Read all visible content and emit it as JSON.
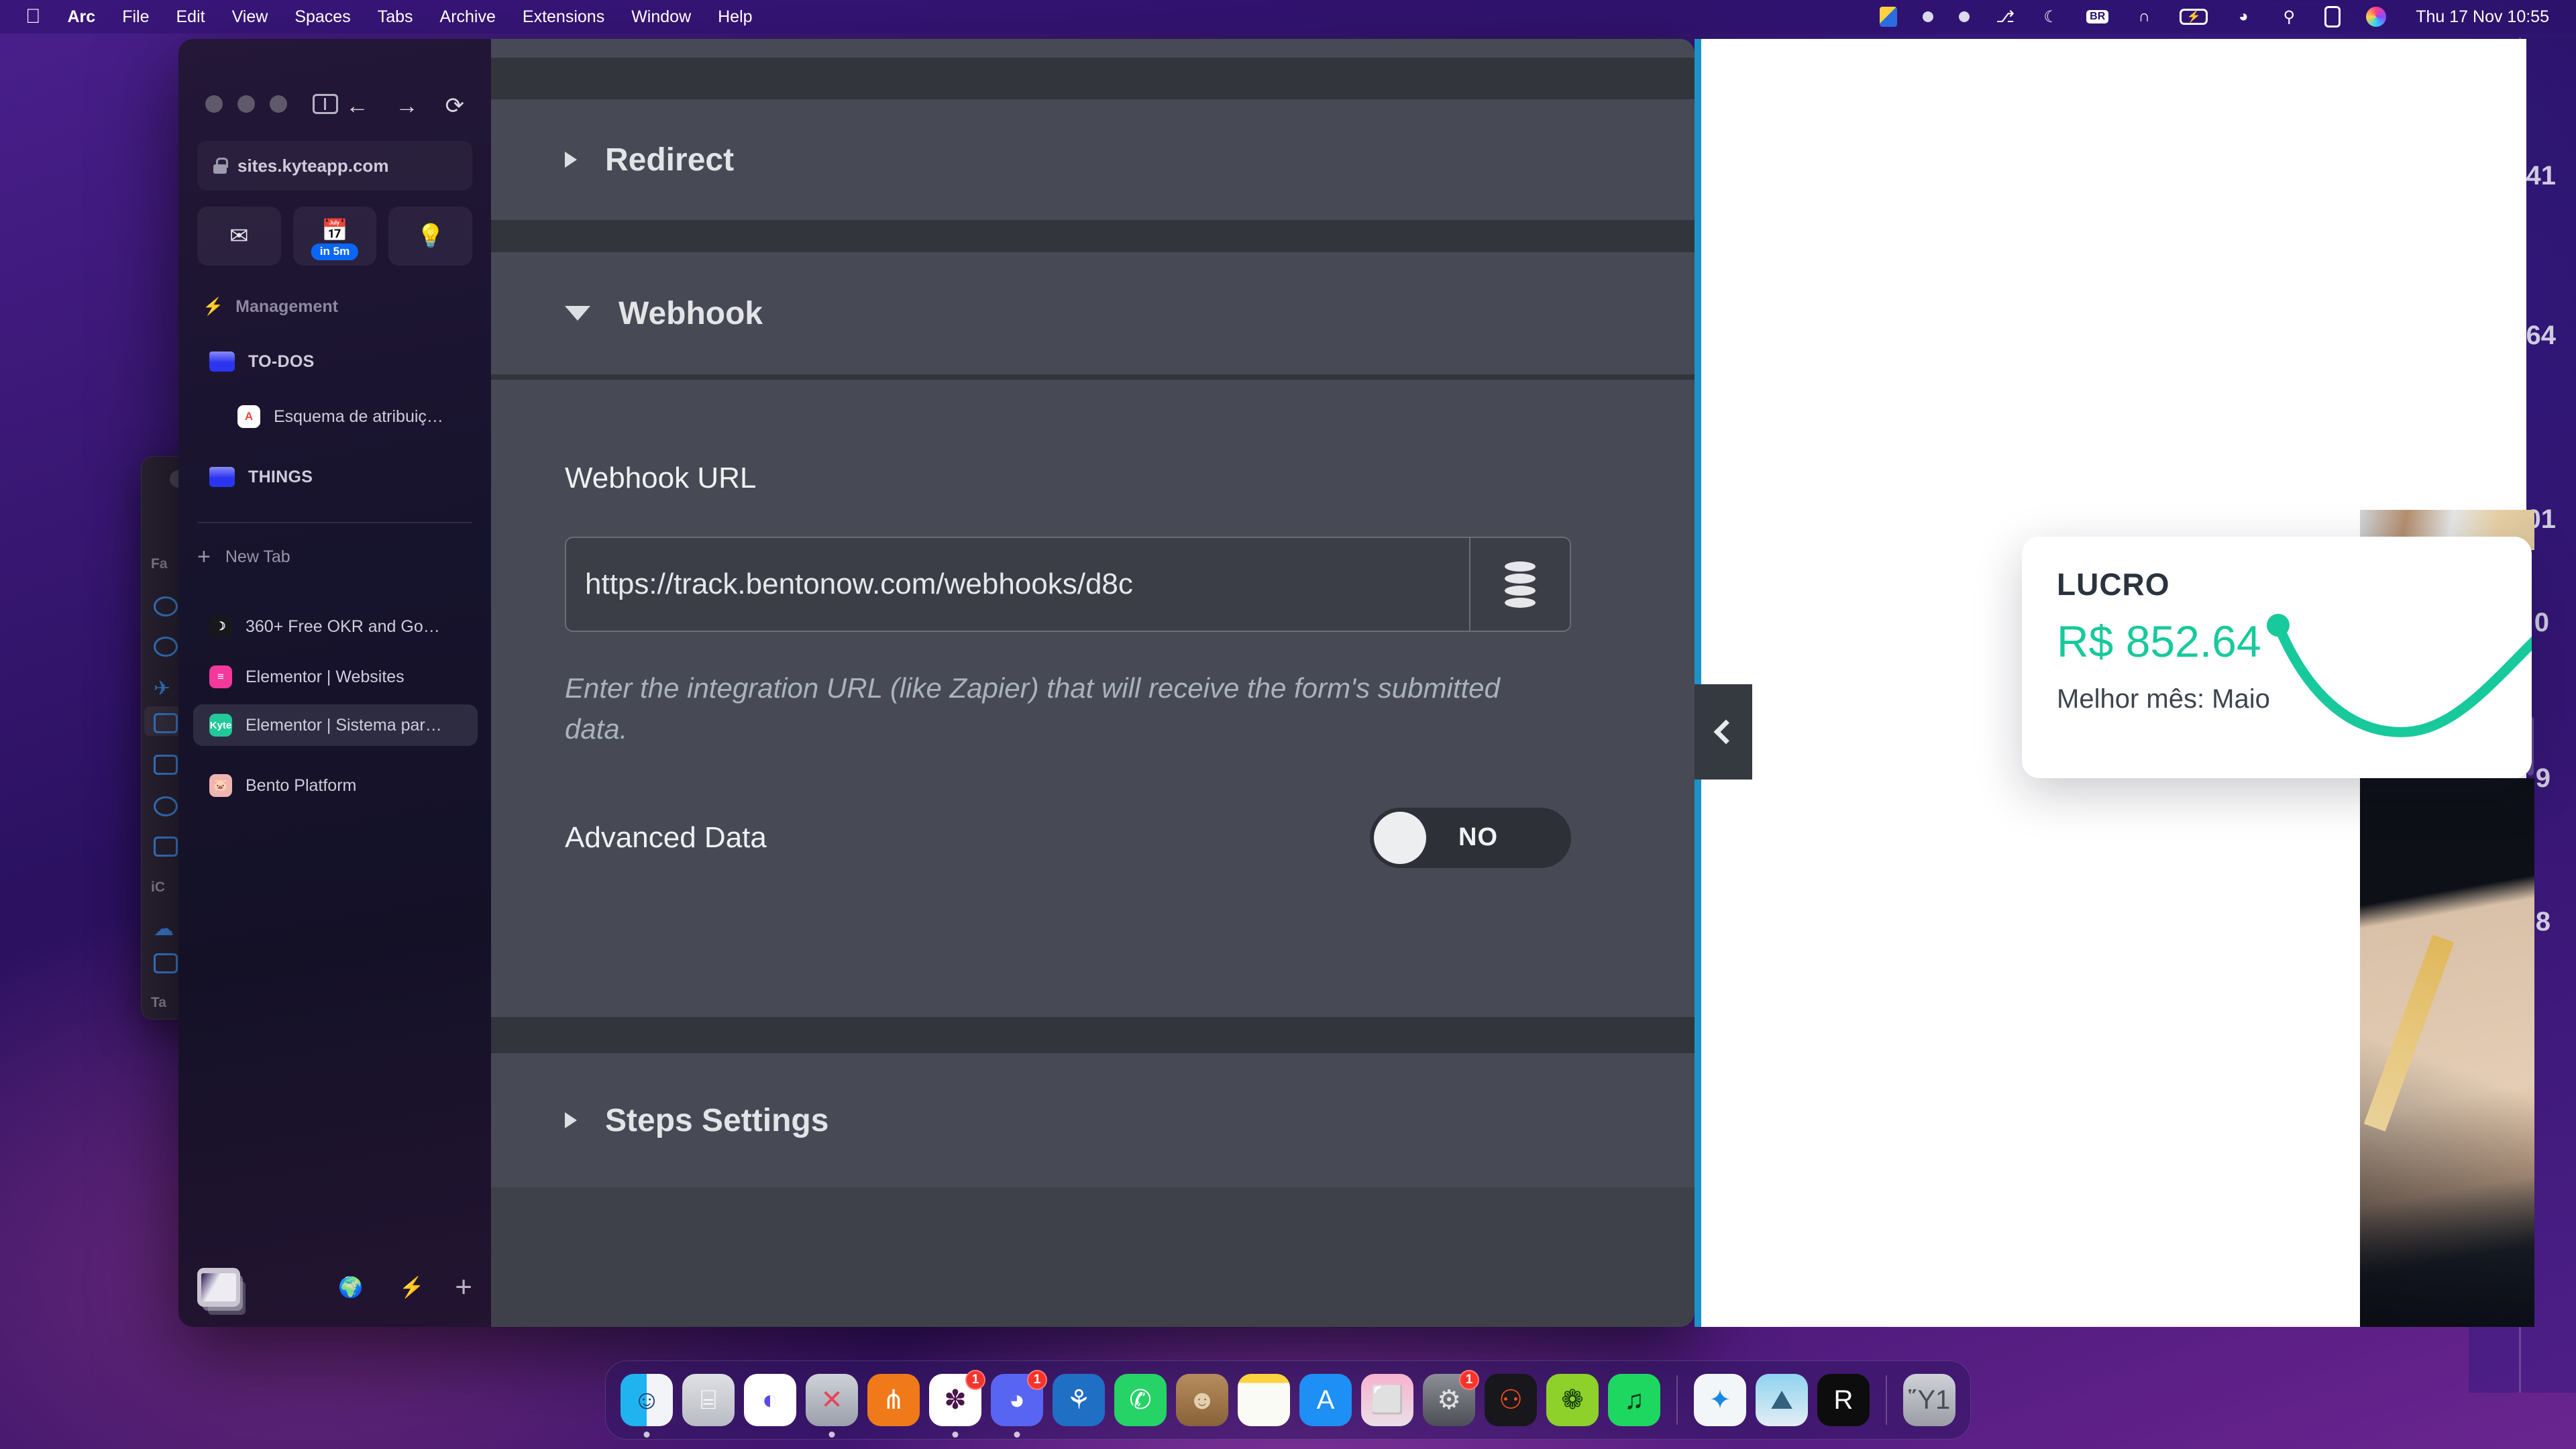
{
  "menubar": {
    "apple_icon": "apple-logo",
    "items": [
      {
        "label": "Arc",
        "bold": true
      },
      {
        "label": "File",
        "bold": false
      },
      {
        "label": "Edit",
        "bold": false
      },
      {
        "label": "View",
        "bold": false
      },
      {
        "label": "Spaces",
        "bold": false
      },
      {
        "label": "Tabs",
        "bold": false
      },
      {
        "label": "Archive",
        "bold": false
      },
      {
        "label": "Extensions",
        "bold": false
      },
      {
        "label": "Window",
        "bold": false
      },
      {
        "label": "Help",
        "bold": false
      }
    ],
    "status_icons": [
      {
        "name": "screen-share-icon",
        "glyph": "◧"
      },
      {
        "name": "status-dot-icon",
        "glyph": ""
      },
      {
        "name": "status-dot-2-icon",
        "glyph": ""
      },
      {
        "name": "bluetooth-icon",
        "glyph": "⎇"
      },
      {
        "name": "do-not-disturb-moon-icon",
        "glyph": "☾"
      },
      {
        "name": "input-language-icon",
        "glyph": "BR"
      },
      {
        "name": "headphones-icon",
        "glyph": "∩"
      },
      {
        "name": "battery-charging-icon",
        "glyph": "⚡"
      },
      {
        "name": "wifi-icon",
        "glyph": "◔"
      },
      {
        "name": "spotlight-search-icon",
        "glyph": "⚲"
      },
      {
        "name": "control-center-icon",
        "glyph": "⌸"
      },
      {
        "name": "siri-icon",
        "glyph": "●"
      }
    ],
    "clock": "Thu 17 Nov  10:55"
  },
  "finder_window": {
    "sections": [
      "Fa",
      "iC",
      "Ta"
    ]
  },
  "browser": {
    "url": "sites.kyteapp.com",
    "nav": {
      "back_icon": "arrow-left-icon",
      "forward_icon": "arrow-right-icon",
      "reload_icon": "reload-icon",
      "sidebar_toggle_icon": "sidebar-toggle-icon"
    },
    "pinned": [
      {
        "name": "mail-tile",
        "glyph": "✉",
        "badge": ""
      },
      {
        "name": "calendar-tile",
        "glyph": "▤",
        "badge": "in 5m"
      },
      {
        "name": "ideas-tile",
        "glyph": "Ὂ1",
        "badge": ""
      }
    ],
    "space_label": "Management",
    "space_icon": "bolt-icon",
    "sidebar_items": [
      {
        "label": "TO-DOS",
        "type": "folder",
        "active": false,
        "indent": false
      },
      {
        "label": "Esquema de atribuiç…",
        "type": "tab",
        "active": false,
        "indent": true,
        "favicon": "A",
        "favicon_bg": "#ffffff",
        "favicon_color": "#e8453c"
      },
      {
        "label": "THINGS",
        "type": "folder",
        "active": false,
        "indent": false
      }
    ],
    "new_tab_label": "New Tab",
    "tabs": [
      {
        "label": "360+ Free OKR and Go…",
        "active": false,
        "favicon": "☽",
        "favicon_bg": "#17171c",
        "favicon_color": "#ffffff"
      },
      {
        "label": "Elementor | Websites",
        "active": false,
        "favicon": "≡",
        "favicon_bg": "#f4389c",
        "favicon_color": "#ffffff"
      },
      {
        "label": "Elementor | Sistema par…",
        "active": true,
        "favicon": "Kyte",
        "favicon_bg": "#22c79a",
        "favicon_color": "#ffffff"
      },
      {
        "label": "Bento Platform",
        "active": false,
        "favicon": "🐷",
        "favicon_bg": "#efb5b0",
        "favicon_color": "#8c4a42"
      }
    ],
    "bottom_bar": [
      {
        "name": "window-preview-button",
        "glyph": ""
      },
      {
        "name": "spaces-planet-icon",
        "glyph": "ἰd"
      },
      {
        "name": "boosts-bolt-icon",
        "glyph": "⚡"
      },
      {
        "name": "new-tab-plus-icon",
        "glyph": "+"
      }
    ]
  },
  "form": {
    "sections": [
      {
        "title": "Redirect",
        "expanded": false
      },
      {
        "title": "Webhook",
        "expanded": true
      },
      {
        "title": "Steps Settings",
        "expanded": false
      }
    ],
    "webhook": {
      "url_label": "Webhook URL",
      "url_value": "https://track.bentonow.com/webhooks/d8c",
      "url_placeholder": "https://",
      "url_button_icon": "database-icon",
      "help_text": "Enter the integration URL (like Zapier) that will receive the form's submitted data.",
      "advanced_data_label": "Advanced Data",
      "advanced_data_state": "NO"
    }
  },
  "preview": {
    "collapse_icon": "chevron-left-icon",
    "card": {
      "title": "LUCRO",
      "value": "R$ 852.64",
      "subtitle": "Melhor mês: Maio",
      "accent_color": "#18c99c"
    },
    "accent_rail_color": "#1b93c9"
  },
  "background_window": {
    "edge_numbers": [
      "41",
      "64",
      "01",
      "0",
      "9",
      "8"
    ]
  },
  "dock": {
    "items": [
      {
        "name": "finder-icon",
        "glyph": "☺",
        "bg": "linear-gradient(90deg,#1fb3f0 0%,#1fb3f0 50%,#f2f4f7 50%)",
        "color": "#133a6b",
        "badge": "",
        "running": true
      },
      {
        "name": "launchpad-icon",
        "glyph": "⌸",
        "bg": "linear-gradient(180deg,#dfe0e4,#b9bcc4)",
        "color": "#fff",
        "badge": "",
        "running": false
      },
      {
        "name": "arc-browser-icon",
        "glyph": "◐",
        "bg": "#ffffff",
        "color": "#5b4ae0",
        "badge": "",
        "running": false
      },
      {
        "name": "affinity-icon",
        "glyph": "✕",
        "bg": "linear-gradient(180deg,#cfd2d8,#9aa0ab)",
        "color": "#e8445c",
        "badge": "",
        "running": true
      },
      {
        "name": "miro-icon",
        "glyph": "⋔",
        "bg": "#f07a1a",
        "color": "#fff",
        "badge": "",
        "running": false
      },
      {
        "name": "slack-icon",
        "glyph": "✽",
        "bg": "#ffffff",
        "color": "#4a154b",
        "badge": "1",
        "running": true
      },
      {
        "name": "discord-icon",
        "glyph": "◕",
        "bg": "#5865f2",
        "color": "#fff",
        "badge": "1",
        "running": true
      },
      {
        "name": "reef-icon",
        "glyph": "⚘",
        "bg": "#1f6fc4",
        "color": "#fff",
        "badge": "",
        "running": false
      },
      {
        "name": "whatsapp-icon",
        "glyph": "✆",
        "bg": "#25d366",
        "color": "#fff",
        "badge": "",
        "running": false
      },
      {
        "name": "contacts-icon",
        "glyph": "☻",
        "bg": "linear-gradient(180deg,#b58d5d,#8a6239)",
        "color": "#e2cfae",
        "badge": "",
        "running": false
      },
      {
        "name": "notes-icon",
        "glyph": "",
        "bg": "linear-gradient(180deg,#fdd33f 0%,#fdd33f 17%,#fbfbf5 17%)",
        "color": "#555",
        "badge": "",
        "running": false
      },
      {
        "name": "app-store-icon",
        "glyph": "A",
        "bg": "#1e8ff5",
        "color": "#fff",
        "badge": "",
        "running": false
      },
      {
        "name": "self-service-icon",
        "glyph": "⬜",
        "bg": "linear-gradient(180deg,#f7b2cf,#eadfe6)",
        "color": "#c94b84",
        "badge": "",
        "running": false
      },
      {
        "name": "system-settings-icon",
        "glyph": "⚙",
        "bg": "linear-gradient(180deg,#8d8f96,#4c4e55)",
        "color": "#dfe1e6",
        "badge": "1",
        "running": false
      },
      {
        "name": "figma-icon",
        "glyph": "⚇",
        "bg": "#17171c",
        "color": "#f24e1e",
        "badge": "",
        "running": false
      },
      {
        "name": "shortcut-icon",
        "glyph": "❁",
        "bg": "#8ed12a",
        "color": "#123a05",
        "badge": "",
        "running": false
      },
      {
        "name": "spotify-icon",
        "glyph": "♫",
        "bg": "#1ed760",
        "color": "#06331a",
        "badge": "",
        "running": false
      },
      {
        "name": "safari-icon",
        "glyph": "✦",
        "bg": "#f3f6f9",
        "color": "#1a8ae0",
        "badge": "",
        "running": false
      },
      {
        "name": "preview-image-icon",
        "glyph": "⛰",
        "bg": "linear-gradient(180deg,#8fd3ef,#e3eef6)",
        "color": "#33617d",
        "badge": "",
        "running": false
      },
      {
        "name": "r-app-icon",
        "glyph": "R",
        "bg": "#0d0d0d",
        "color": "#ffffff",
        "badge": "",
        "running": false
      },
      {
        "name": "trash-icon",
        "glyph": "Ὕ1",
        "bg": "linear-gradient(180deg,#cfd2d7,#9a9da4)",
        "color": "#4a4d53",
        "badge": "",
        "running": false
      }
    ]
  }
}
